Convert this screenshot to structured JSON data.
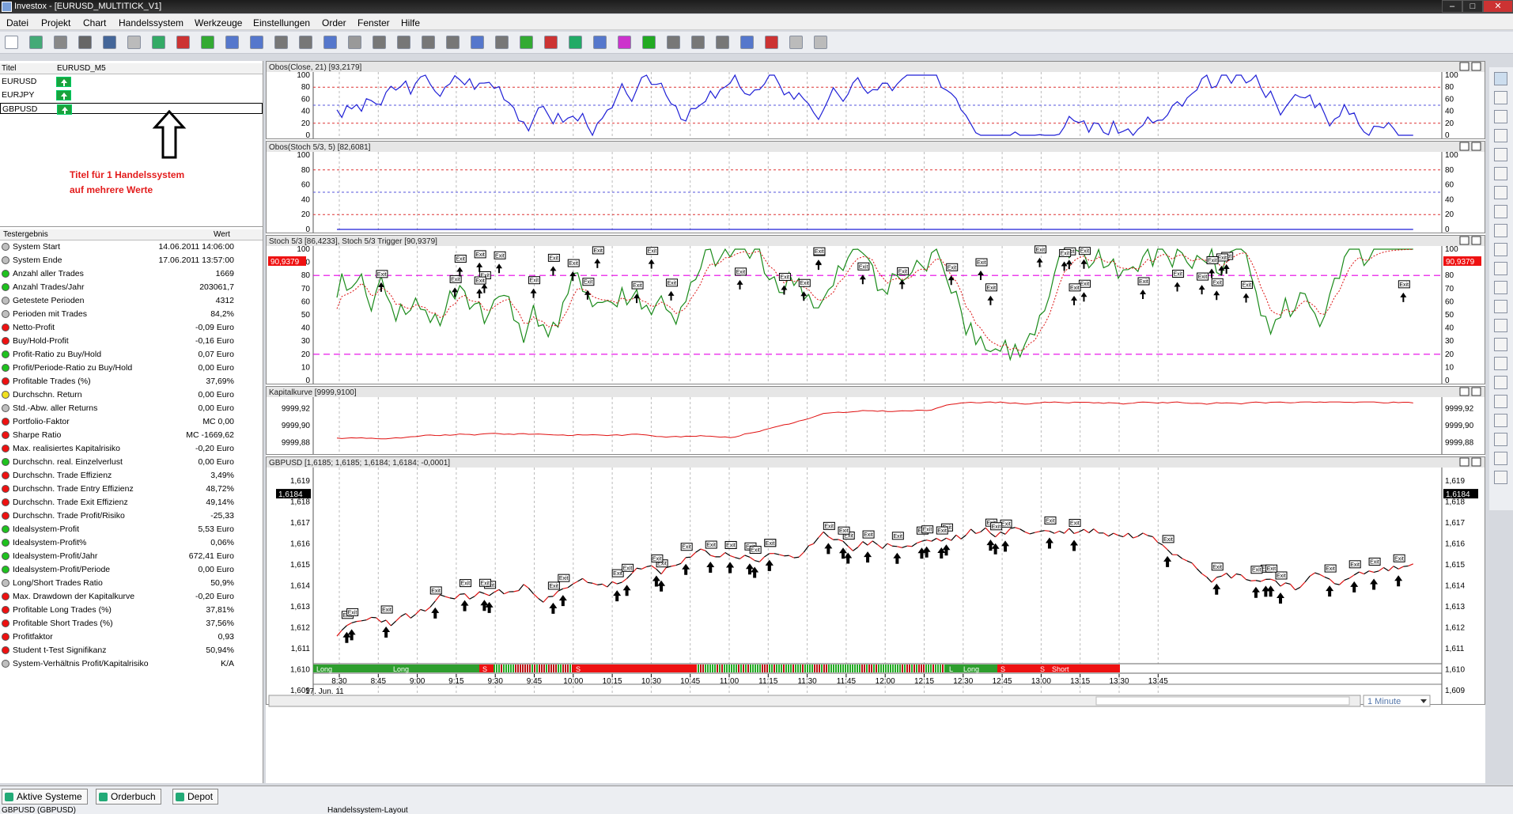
{
  "window": {
    "title": "Investox - [EURUSD_MULTITICK_V1]"
  },
  "menu": [
    "Datei",
    "Projekt",
    "Chart",
    "Handelssystem",
    "Werkzeuge",
    "Einstellungen",
    "Order",
    "Fenster",
    "Hilfe"
  ],
  "symbols_table": {
    "col_title": "Titel",
    "col_name": "EURUSD_M5",
    "rows": [
      "EURUSD",
      "EURJPY",
      "GBPUSD"
    ]
  },
  "annotation": {
    "text": "Titel für 1 Handelssystem auf mehrere Werte"
  },
  "results": {
    "col_label": "Testergebnis",
    "col_value": "Wert",
    "rows": [
      {
        "label": "System Start",
        "value": "14.06.2011 14:06:00",
        "status": "#bfbfbf"
      },
      {
        "label": "System Ende",
        "value": "17.06.2011 13:57:00",
        "status": "#bfbfbf"
      },
      {
        "label": "Anzahl aller Trades",
        "value": "1669",
        "status": "#1fc21f"
      },
      {
        "label": "Anzahl Trades/Jahr",
        "value": "203061,7",
        "status": "#1fc21f"
      },
      {
        "label": "Getestete Perioden",
        "value": "4312",
        "status": "#bfbfbf"
      },
      {
        "label": "Perioden mit Trades",
        "value": "84,2%",
        "status": "#bfbfbf"
      },
      {
        "label": "Netto-Profit",
        "value": "-0,09 Euro",
        "status": "#e11"
      },
      {
        "label": "Buy/Hold-Profit",
        "value": "-0,16 Euro",
        "status": "#e11"
      },
      {
        "label": "Profit-Ratio zu Buy/Hold",
        "value": "0,07 Euro",
        "status": "#1fc21f"
      },
      {
        "label": "Profit/Periode-Ratio zu Buy/Hold",
        "value": "0,00 Euro",
        "status": "#1fc21f"
      },
      {
        "label": "Profitable Trades (%)",
        "value": "37,69%",
        "status": "#e11"
      },
      {
        "label": "Durchschn. Return",
        "value": "0,00 Euro",
        "status": "#f0e020"
      },
      {
        "label": "Std.-Abw. aller Returns",
        "value": "0,00 Euro",
        "status": "#bfbfbf"
      },
      {
        "label": "Portfolio-Faktor",
        "value": "MC 0,00",
        "status": "#e11"
      },
      {
        "label": "Sharpe Ratio",
        "value": "MC -1669,62",
        "status": "#e11"
      },
      {
        "label": "Max. realisiertes Kapitalrisiko",
        "value": "-0,20 Euro",
        "status": "#e11"
      },
      {
        "label": "Durchschn. real. Einzelverlust",
        "value": "0,00 Euro",
        "status": "#1fc21f"
      },
      {
        "label": "Durchschn. Trade Effizienz",
        "value": "3,49%",
        "status": "#e11"
      },
      {
        "label": "Durchschn. Trade Entry Effizienz",
        "value": "48,72%",
        "status": "#e11"
      },
      {
        "label": "Durchschn. Trade Exit Effizienz",
        "value": "49,14%",
        "status": "#e11"
      },
      {
        "label": "Durchschn. Trade Profit/Risiko",
        "value": "-25,33",
        "status": "#e11"
      },
      {
        "label": "Idealsystem-Profit",
        "value": "5,53 Euro",
        "status": "#1fc21f"
      },
      {
        "label": "Idealsystem-Profit%",
        "value": "0,06%",
        "status": "#1fc21f"
      },
      {
        "label": "Idealsystem-Profit/Jahr",
        "value": "672,41 Euro",
        "status": "#1fc21f"
      },
      {
        "label": "Idealsystem-Profit/Periode",
        "value": "0,00 Euro",
        "status": "#1fc21f"
      },
      {
        "label": "Long/Short Trades Ratio",
        "value": "50,9%",
        "status": "#bfbfbf"
      },
      {
        "label": "Max. Drawdown der Kapitalkurve",
        "value": "-0,20 Euro",
        "status": "#e11"
      },
      {
        "label": "Profitable Long Trades (%)",
        "value": "37,81%",
        "status": "#e11"
      },
      {
        "label": "Profitable Short Trades (%)",
        "value": "37,56%",
        "status": "#e11"
      },
      {
        "label": "Profitfaktor",
        "value": "0,93",
        "status": "#e11"
      },
      {
        "label": "Student t-Test Signifikanz",
        "value": "50,94%",
        "status": "#e11"
      },
      {
        "label": "System-Verhältnis Profit/Kapitalrisiko",
        "value": "K/A",
        "status": "#bfbfbf"
      }
    ]
  },
  "panels": {
    "p1": {
      "title": "Obos(Close, 21) [93,2179]",
      "ticks": [
        "100",
        "80",
        "60",
        "40",
        "20",
        "0"
      ]
    },
    "p2": {
      "title": "Obos(Stoch 5/3, 5) [82,6081]",
      "ticks": [
        "100",
        "80",
        "60",
        "40",
        "20",
        "0"
      ]
    },
    "p3": {
      "title": "Stoch 5/3 [86,4233], Stoch 5/3 Trigger [90,9379]",
      "ticks": [
        "100",
        "90",
        "80",
        "70",
        "60",
        "50",
        "40",
        "30",
        "20",
        "10",
        "0"
      ],
      "badge": "90,9379"
    },
    "p4": {
      "title": "Kapitalkurve [9999,9100]",
      "ticks": [
        "9999,92",
        "9999,90",
        "9999,88"
      ]
    },
    "p5": {
      "title": "GBPUSD [1,6185; 1,6185; 1,6184; 1,6184; -0,0001]",
      "ticks": [
        "1,619",
        "1,618",
        "1,617",
        "1,616",
        "1,615",
        "1,614",
        "1,613",
        "1,612",
        "1,611",
        "1,610",
        "1,609"
      ],
      "badge": "1,6184"
    }
  },
  "trade_marker": {
    "exit_label": "Exit"
  },
  "signal_strip": [
    "Long",
    "Long",
    "S",
    "S",
    "L",
    "Long",
    "S",
    "S",
    "Short"
  ],
  "time_axis": {
    "ticks": [
      "8:30",
      "8:45",
      "9:00",
      "9:15",
      "9:30",
      "9:45",
      "10:00",
      "10:15",
      "10:30",
      "10:45",
      "11:00",
      "11:15",
      "11:30",
      "11:45",
      "12:00",
      "12:15",
      "12:30",
      "12:45",
      "13:00",
      "13:15",
      "13:30",
      "13:45"
    ],
    "date": "17. Jun. 11"
  },
  "scroll": {
    "interval": "1 Minute"
  },
  "bottom": {
    "tabs": [
      "Aktive Systeme",
      "Orderbuch",
      "Depot"
    ],
    "status_left": "GBPUSD (GBPUSD)",
    "status_right": "Handelssystem-Layout"
  },
  "colors": {
    "obos": "#1f1fd6",
    "stoch": "#1a8a1a",
    "trigger": "#d11",
    "equity": "#e01010",
    "guide": "#e600e6"
  }
}
